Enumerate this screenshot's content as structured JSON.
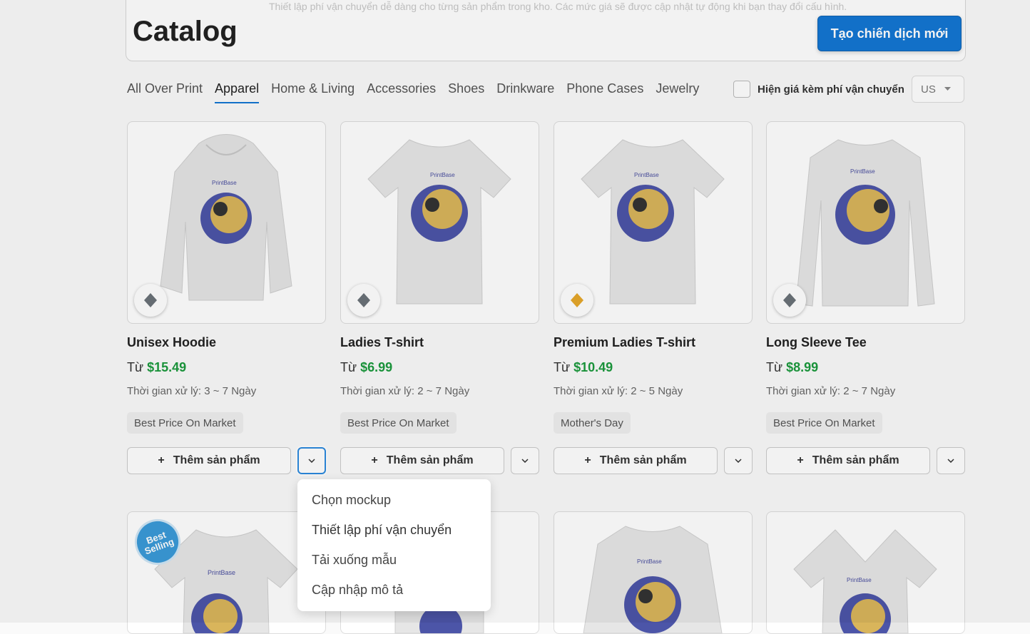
{
  "header": {
    "title": "Catalog",
    "cta_label": "Tạo chiến dịch mới",
    "banner_ghost": "Thiết lập phí vận chuyển dễ dàng cho từng sản phẩm trong kho. Các mức giá sẽ được cập nhật tự động khi bạn thay đổi cấu hình."
  },
  "tabs": [
    "All Over Print",
    "Apparel",
    "Home & Living",
    "Accessories",
    "Shoes",
    "Drinkware",
    "Phone Cases",
    "Jewelry"
  ],
  "active_tab": "Apparel",
  "shipping_toggle": {
    "label": "Hiện giá kèm phí vận chuyển",
    "country": "US"
  },
  "products": [
    {
      "name": "Unisex Hoodie",
      "price_prefix": "Từ",
      "price": "$15.49",
      "processing": "Thời gian xử lý: 3 ~ 7 Ngày",
      "tag": "Best Price On Market",
      "add_label": "Thêm sản phẩm",
      "badge_color": "#6b7279"
    },
    {
      "name": "Ladies T-shirt",
      "price_prefix": "Từ",
      "price": "$6.99",
      "processing": "Thời gian xử lý: 2 ~ 7 Ngày",
      "tag": "Best Price On Market",
      "add_label": "Thêm sản phẩm",
      "badge_color": "#6b7279"
    },
    {
      "name": "Premium Ladies T-shirt",
      "price_prefix": "Từ",
      "price": "$10.49",
      "processing": "Thời gian xử lý: 2 ~ 5 Ngày",
      "tag": "Mother's Day",
      "add_label": "Thêm sản phẩm",
      "badge_color": "#e6a82b"
    },
    {
      "name": "Long Sleeve Tee",
      "price_prefix": "Từ",
      "price": "$8.99",
      "processing": "Thời gian xử lý: 2 ~ 7 Ngày",
      "tag": "Best Price On Market",
      "add_label": "Thêm sản phẩm",
      "badge_color": "#6b7279"
    }
  ],
  "second_row": {
    "best_selling_badge": "Best Selling",
    "logo_text": "PrintBase"
  },
  "dropdown_menu": {
    "items": [
      "Chọn mockup",
      "Thiết lập phí vận chuyển",
      "Tải xuống mẫu",
      "Cập nhập mô tả"
    ],
    "highlighted_index": 1
  },
  "colors": {
    "accent": "#1477d3",
    "price_green": "#1c9a3e"
  }
}
